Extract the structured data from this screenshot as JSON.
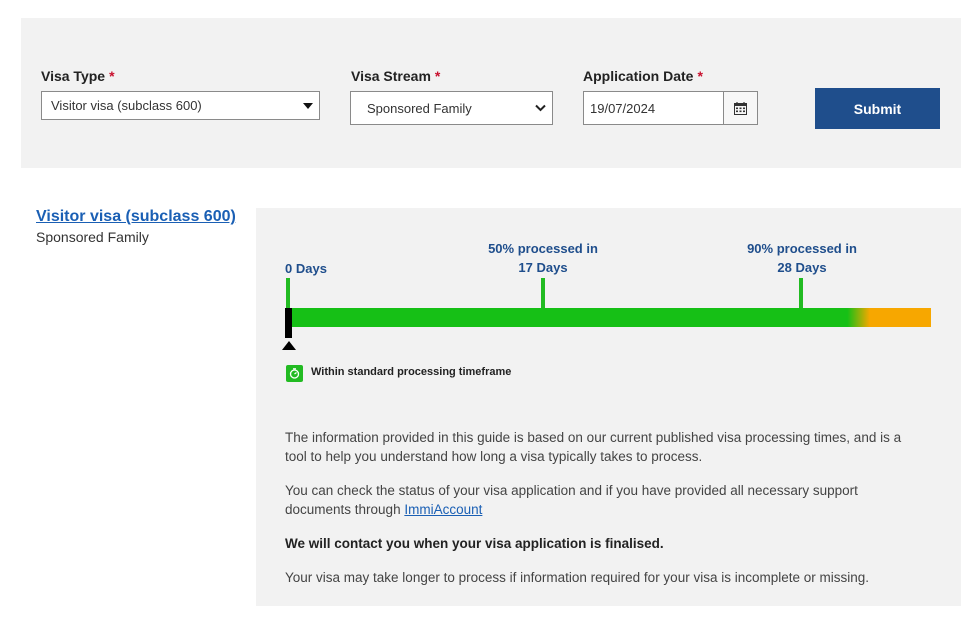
{
  "form": {
    "visa_type": {
      "label": "Visa Type",
      "required_mark": "*",
      "value": "Visitor visa (subclass 600)"
    },
    "visa_stream": {
      "label": "Visa Stream",
      "required_mark": "*",
      "value": "Sponsored Family"
    },
    "application_date": {
      "label": "Application Date",
      "required_mark": "*",
      "value": "19/07/2024"
    },
    "submit_label": "Submit"
  },
  "result": {
    "visa_title": "Visitor visa (subclass 600)",
    "stream": "Sponsored Family",
    "timeline": {
      "start_label": "0 Days",
      "mid_label_line1": "50% processed in",
      "mid_label_line2": "17 Days",
      "end_label_line1": "90% processed in",
      "end_label_line2": "28 Days",
      "status_text": "Within standard processing timeframe"
    },
    "info": {
      "p1": "The information provided in this guide is based on our current published visa processing times, and is a tool to help you understand how long a visa typically takes to process.",
      "p2_text": "You can check the status of your visa application and if you have provided all necessary support documents through",
      "p2_link": "ImmiAccount",
      "p3": "We will contact you when your visa application is finalised.",
      "p4": "Your visa may take longer to process if information required for your visa is incomplete or missing."
    }
  },
  "colors": {
    "primary_button": "#1f4e8c",
    "link": "#1a5fb4",
    "progress_green": "#16c016",
    "progress_orange": "#f7a700",
    "required_red": "#c8102e"
  }
}
